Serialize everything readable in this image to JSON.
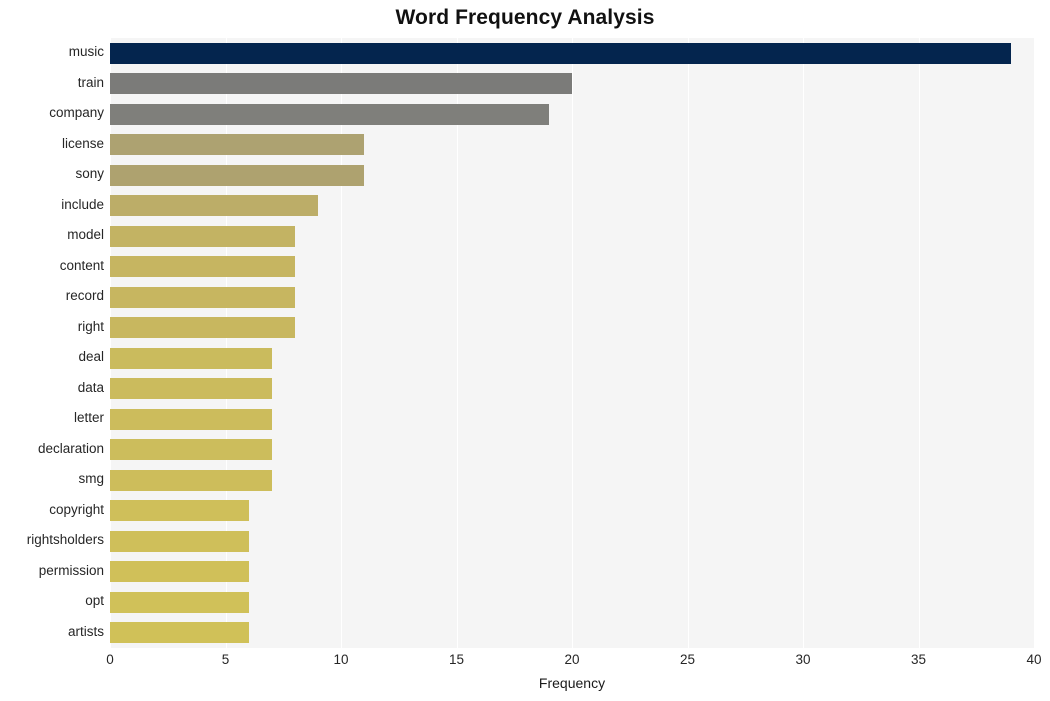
{
  "chart_data": {
    "type": "bar",
    "orientation": "horizontal",
    "title": "Word Frequency Analysis",
    "xlabel": "Frequency",
    "ylabel": "",
    "xlim": [
      0,
      40
    ],
    "xticks": [
      0,
      5,
      10,
      15,
      20,
      25,
      30,
      35,
      40
    ],
    "xtick_labels": [
      "0",
      "5",
      "10",
      "15",
      "20",
      "25",
      "30",
      "35",
      "40"
    ],
    "grid": "vertical-only",
    "legend": "none",
    "categories": [
      "music",
      "train",
      "company",
      "license",
      "sony",
      "include",
      "model",
      "content",
      "record",
      "right",
      "deal",
      "data",
      "letter",
      "declaration",
      "smg",
      "copyright",
      "rightsholders",
      "permission",
      "opt",
      "artists"
    ],
    "values": [
      39,
      20,
      19,
      11,
      11,
      9,
      8,
      8,
      8,
      8,
      7,
      7,
      7,
      7,
      7,
      6,
      6,
      6,
      6,
      6
    ],
    "bar_colors": [
      "#04254e",
      "#7b7b79",
      "#7f7f7b",
      "#ada271",
      "#aea26f",
      "#bcad68",
      "#c3b363",
      "#c6b561",
      "#c7b660",
      "#c8b75f",
      "#cabb5d",
      "#cbbb5d",
      "#ccbc5c",
      "#ccbd5c",
      "#cdbd5b",
      "#cfbf5a",
      "#cfbf5a",
      "#d0c059",
      "#d0c159",
      "#d0c158"
    ],
    "colors": {
      "plot_background": "#f5f5f5",
      "figure_background": "#ffffff",
      "gridline": "#ffffff",
      "tick_label": "#262626",
      "title": "#111111"
    }
  }
}
